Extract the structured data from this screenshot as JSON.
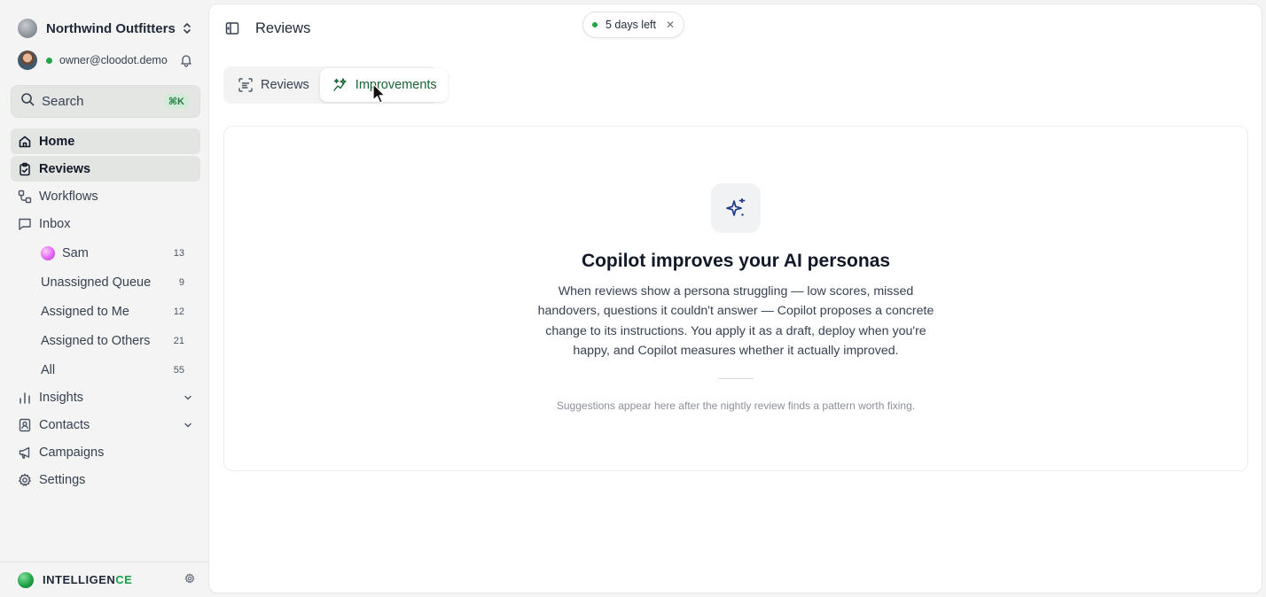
{
  "sidebar": {
    "org_name": "Northwind Outfitters",
    "user_email": "owner@cloodot.demo",
    "search": {
      "label": "Search",
      "shortcut": "⌘K"
    },
    "nav": {
      "home": "Home",
      "reviews": "Reviews",
      "workflows": "Workflows",
      "inbox": "Inbox",
      "insights": "Insights",
      "contacts": "Contacts",
      "campaigns": "Campaigns",
      "settings": "Settings"
    },
    "inbox_items": [
      {
        "label": "Sam",
        "count": "13"
      },
      {
        "label": "Unassigned Queue",
        "count": "9"
      },
      {
        "label": "Assigned to Me",
        "count": "12"
      },
      {
        "label": "Assigned to Others",
        "count": "21"
      },
      {
        "label": "All",
        "count": "55"
      }
    ],
    "footer": {
      "brand_main": "INTELLIGEN",
      "brand_accent": "CE"
    }
  },
  "header": {
    "title": "Reviews",
    "trial": {
      "text": "5 days left",
      "close": "✕"
    }
  },
  "tabs": [
    {
      "label": "Reviews",
      "selected": false
    },
    {
      "label": "Improvements",
      "selected": true
    }
  ],
  "empty_state": {
    "title": "Copilot improves your AI personas",
    "body": "When reviews show a persona struggling — low scores, missed handovers, questions it couldn't answer — Copilot proposes a concrete change to its instructions. You apply it as a draft, deploy when you're happy, and Copilot measures whether it actually improved.",
    "note": "Suggestions appear here after the nightly review finds a pattern worth fixing."
  },
  "colors": {
    "accent_green": "#16a34a",
    "status_green": "#22a447",
    "hero_icon_blue": "#1e3a8a"
  }
}
